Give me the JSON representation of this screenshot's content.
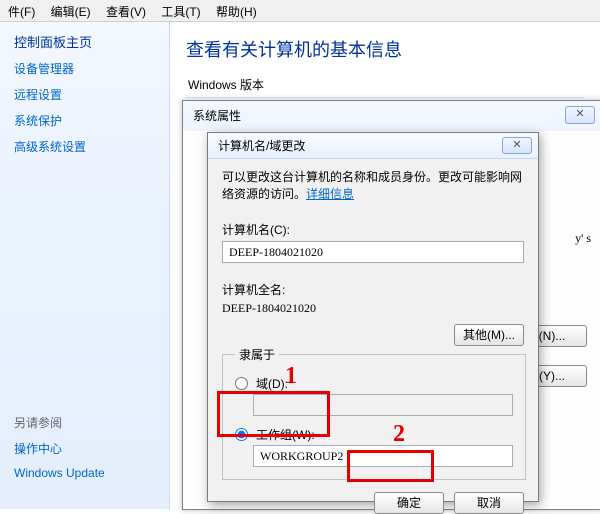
{
  "menu": {
    "file": "件(F)",
    "edit": "编辑(E)",
    "view": "查看(V)",
    "tools": "工具(T)",
    "help": "帮助(H)"
  },
  "sidebar": {
    "head": "控制面板主页",
    "links": [
      "设备管理器",
      "远程设置",
      "系统保护",
      "高级系统设置"
    ],
    "seealso_head": "另请参阅",
    "seealso": [
      "操作中心",
      "Windows Update"
    ]
  },
  "main": {
    "title": "查看有关计算机的基本信息",
    "section1": "Windows 版本"
  },
  "dlg_outer": {
    "title": "系统属性",
    "frag1": "y' s",
    "btn_change_n": "(N)...",
    "btn_change_y": "(Y)..."
  },
  "dlg_inner": {
    "title": "计算机名/域更改",
    "desc1": "可以更改这台计算机的名称和成员身份。更改可能影响网络资源的访问。",
    "desc_link": "详细信息",
    "label_computer_name": "计算机名(C):",
    "computer_name": "DEEP-1804021020",
    "label_full_name": "计算机全名:",
    "full_name": "DEEP-1804021020",
    "btn_other": "其他(M)...",
    "fieldset_legend": "隶属于",
    "radio_domain": "域(D):",
    "domain_value": "",
    "radio_workgroup": "工作组(W):",
    "workgroup_value": "WORKGROUP2",
    "btn_ok": "确定",
    "btn_cancel": "取消"
  },
  "anno": {
    "n1": "1",
    "n2": "2"
  }
}
